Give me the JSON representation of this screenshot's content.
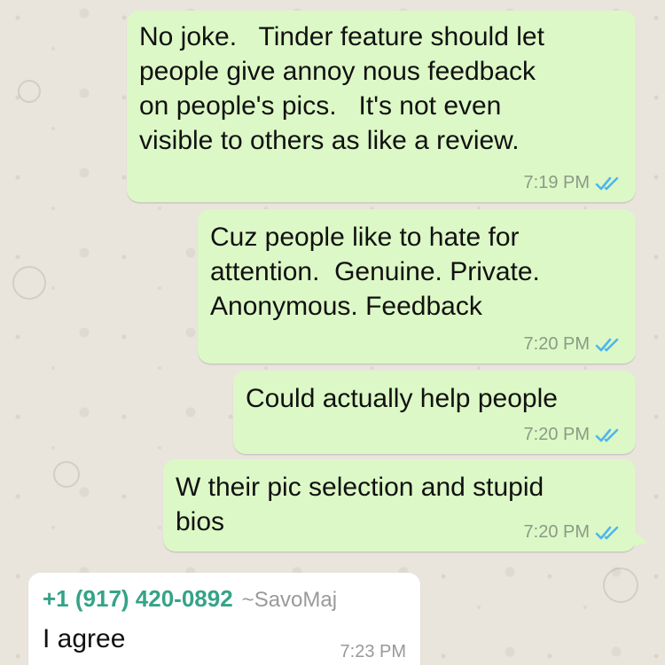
{
  "theme": {
    "outgoing_bubble": "#dcf8c6",
    "incoming_bubble": "#ffffff",
    "tick_color": "#4fb6ec",
    "sender_color": "#35a387",
    "wallpaper": "#e9e5dd"
  },
  "messages": [
    {
      "text": "No joke.   Tinder feature should let\npeople give annoy nous feedback\non people's pics.   It's not even\nvisible to others as like a review.",
      "time": "7:19 PM",
      "status_icon": "double-check-icon"
    },
    {
      "text": "Cuz people like to hate for\nattention.  Genuine. Private.\nAnonymous. Feedback",
      "time": "7:20 PM",
      "status_icon": "double-check-icon"
    },
    {
      "text": "Could actually help people",
      "time": "7:20 PM",
      "status_icon": "double-check-icon"
    },
    {
      "text": "W their pic selection and stupid\nbios",
      "time": "7:20 PM",
      "status_icon": "double-check-icon"
    }
  ],
  "incoming": {
    "phone": "+1 (917) 420-0892",
    "name": "~SavoMaj",
    "text": "I agree",
    "time": "7:23 PM"
  }
}
